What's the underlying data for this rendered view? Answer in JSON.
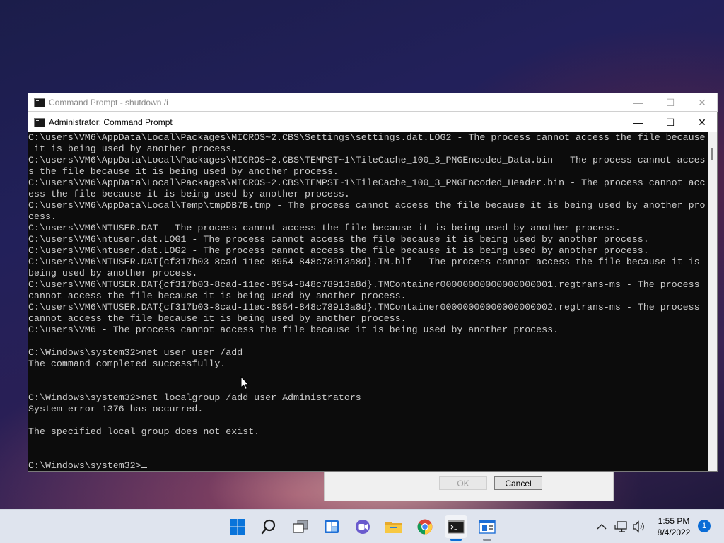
{
  "shutdown_dialog": {
    "ok_label": "OK",
    "cancel_label": "Cancel"
  },
  "back_window": {
    "title": "Command Prompt - shutdown  /i",
    "controls": {
      "minimize": "—",
      "maximize": "☐",
      "close": "✕"
    }
  },
  "front_window": {
    "title": "Administrator: Command Prompt",
    "controls": {
      "minimize": "—",
      "maximize": "☐",
      "close": "✕"
    },
    "console_lines": [
      "C:\\users\\VM6\\AppData\\Local\\Packages\\MICROS~2.CBS\\Settings\\settings.dat.LOG2 - The process cannot access the file because",
      " it is being used by another process.",
      "C:\\users\\VM6\\AppData\\Local\\Packages\\MICROS~2.CBS\\TEMPST~1\\TileCache_100_3_PNGEncoded_Data.bin - The process cannot acces",
      "s the file because it is being used by another process.",
      "C:\\users\\VM6\\AppData\\Local\\Packages\\MICROS~2.CBS\\TEMPST~1\\TileCache_100_3_PNGEncoded_Header.bin - The process cannot acc",
      "ess the file because it is being used by another process.",
      "C:\\users\\VM6\\AppData\\Local\\Temp\\tmpDB7B.tmp - The process cannot access the file because it is being used by another pro",
      "cess.",
      "C:\\users\\VM6\\NTUSER.DAT - The process cannot access the file because it is being used by another process.",
      "C:\\users\\VM6\\ntuser.dat.LOG1 - The process cannot access the file because it is being used by another process.",
      "C:\\users\\VM6\\ntuser.dat.LOG2 - The process cannot access the file because it is being used by another process.",
      "C:\\users\\VM6\\NTUSER.DAT{cf317b03-8cad-11ec-8954-848c78913a8d}.TM.blf - The process cannot access the file because it is",
      "being used by another process.",
      "C:\\users\\VM6\\NTUSER.DAT{cf317b03-8cad-11ec-8954-848c78913a8d}.TMContainer00000000000000000001.regtrans-ms - The process",
      "cannot access the file because it is being used by another process.",
      "C:\\users\\VM6\\NTUSER.DAT{cf317b03-8cad-11ec-8954-848c78913a8d}.TMContainer00000000000000000002.regtrans-ms - The process",
      "cannot access the file because it is being used by another process.",
      "C:\\users\\VM6 - The process cannot access the file because it is being used by another process.",
      "",
      "C:\\Windows\\system32>net user user /add",
      "The command completed successfully.",
      "",
      "",
      "C:\\Windows\\system32>net localgroup /add user Administrators",
      "System error 1376 has occurred.",
      "",
      "The specified local group does not exist.",
      "",
      ""
    ],
    "prompt": "C:\\Windows\\system32>"
  },
  "taskbar": {
    "items": [
      {
        "name": "start-icon"
      },
      {
        "name": "search-icon"
      },
      {
        "name": "task-view-icon"
      },
      {
        "name": "widgets-icon"
      },
      {
        "name": "teams-chat-icon"
      },
      {
        "name": "file-explorer-icon"
      },
      {
        "name": "chrome-icon"
      },
      {
        "name": "command-prompt-icon",
        "active": true
      },
      {
        "name": "shutdown-dialog-icon"
      }
    ],
    "tray": {
      "chevron": "^",
      "time": "1:55 PM",
      "date": "8/4/2022",
      "notification_count": "1"
    }
  },
  "colors": {
    "console_bg": "#0c0c0c",
    "console_text": "#cccccc",
    "accent": "#0a6cd6"
  }
}
